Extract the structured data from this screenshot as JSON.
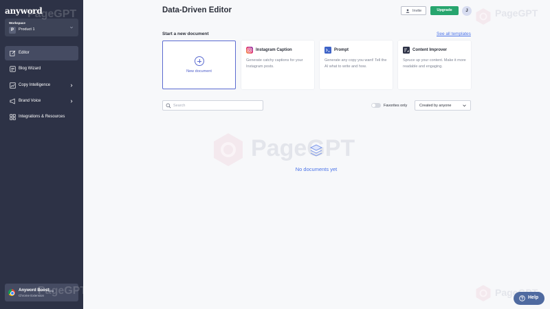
{
  "sidebar": {
    "logo": "anyword",
    "workspace": {
      "caption": "Workspace",
      "avatar_letter": "P",
      "name": "Product 1"
    },
    "items": [
      {
        "label": "Editor",
        "icon": "edit-icon",
        "active": true,
        "has_arrow": false
      },
      {
        "label": "Blog Wizard",
        "icon": "blog-icon",
        "active": false,
        "has_arrow": false
      },
      {
        "label": "Copy Intelligence",
        "icon": "chart-icon",
        "active": false,
        "has_arrow": true
      },
      {
        "label": "Brand Voice",
        "icon": "megaphone-icon",
        "active": false,
        "has_arrow": true
      },
      {
        "label": "Integrations & Resources",
        "icon": "grid-icon",
        "active": false,
        "has_arrow": false
      }
    ],
    "extension": {
      "title": "Anyword Boost",
      "badge": "Beta",
      "subtitle": "Chrome Extension"
    }
  },
  "header": {
    "title": "Data-Driven Editor",
    "invite_label": "Invite",
    "upgrade_label": "Upgrade",
    "avatar_letter": "J"
  },
  "templates": {
    "section_title": "Start a new document",
    "see_all": "See all templates",
    "new_document": "New document",
    "cards": [
      {
        "title": "Instagram Caption",
        "desc": "Generate catchy captions for your Instagram posts.",
        "icon": "instagram-icon"
      },
      {
        "title": "Prompt",
        "desc": "Generate any copy you want! Tell the AI what to write and how.",
        "icon": "terminal-icon"
      },
      {
        "title": "Content Improver",
        "desc": "Spruce up your content. Make it more readable and engaging.",
        "icon": "improve-icon"
      }
    ]
  },
  "filters": {
    "search_placeholder": "Search",
    "favorites_label": "Favorites only",
    "favorites_on": false,
    "created_by": "Created by anyone"
  },
  "empty_state": "No documents yet",
  "watermark": "PageGPT",
  "help_label": "Help",
  "colors": {
    "sidebar": "#2d3246",
    "accent": "#4a72e8",
    "upgrade": "#27a56e"
  }
}
